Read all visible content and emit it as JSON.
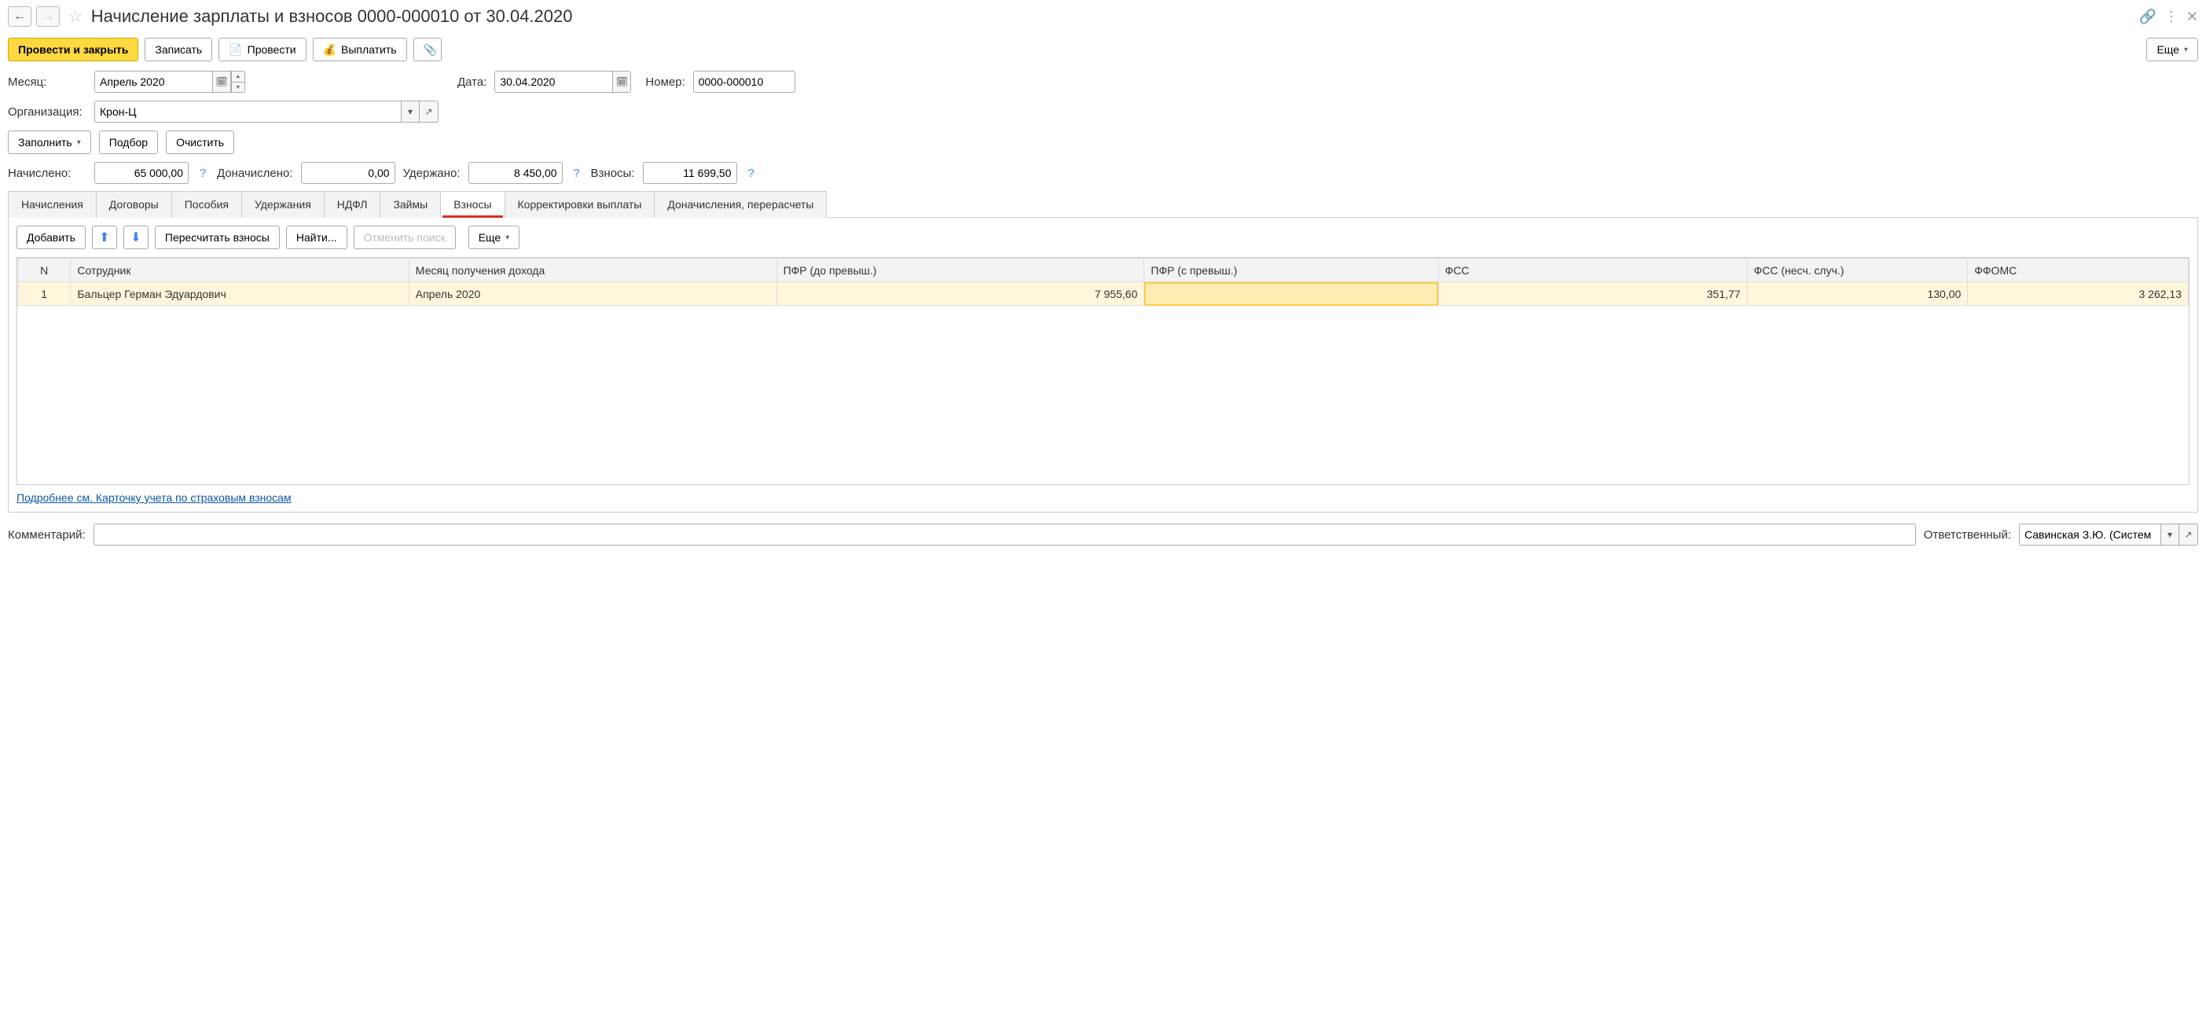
{
  "header": {
    "title": "Начисление зарплаты и взносов 0000-000010 от 30.04.2020"
  },
  "toolbar": {
    "post_and_close": "Провести и закрыть",
    "save": "Записать",
    "post": "Провести",
    "pay": "Выплатить",
    "more": "Еще"
  },
  "form": {
    "month_label": "Месяц:",
    "month_value": "Апрель 2020",
    "date_label": "Дата:",
    "date_value": "30.04.2020",
    "number_label": "Номер:",
    "number_value": "0000-000010",
    "org_label": "Организация:",
    "org_value": "Крон-Ц"
  },
  "mid_toolbar": {
    "fill": "Заполнить",
    "pick": "Подбор",
    "clear": "Очистить"
  },
  "summary": {
    "accrued_label": "Начислено:",
    "accrued_value": "65 000,00",
    "additional_label": "Доначислено:",
    "additional_value": "0,00",
    "withheld_label": "Удержано:",
    "withheld_value": "8 450,00",
    "contrib_label": "Взносы:",
    "contrib_value": "11 699,50"
  },
  "tabs": {
    "items": [
      {
        "label": "Начисления"
      },
      {
        "label": "Договоры"
      },
      {
        "label": "Пособия"
      },
      {
        "label": "Удержания"
      },
      {
        "label": "НДФЛ"
      },
      {
        "label": "Займы"
      },
      {
        "label": "Взносы"
      },
      {
        "label": "Корректировки выплаты"
      },
      {
        "label": "Доначисления, перерасчеты"
      }
    ],
    "active_index": 6
  },
  "inner_toolbar": {
    "add": "Добавить",
    "recalc": "Пересчитать взносы",
    "find": "Найти...",
    "cancel_find": "Отменить поиск",
    "more": "Еще"
  },
  "grid": {
    "columns": [
      "N",
      "Сотрудник",
      "Месяц получения дохода",
      "ПФР (до превыш.)",
      "ПФР (с превыш.)",
      "ФСС",
      "ФСС (несч. случ.)",
      "ФФОМС"
    ],
    "rows": [
      {
        "n": "1",
        "employee": "Бальцер Герман Эдуардович",
        "month": "Апрель 2020",
        "pfr_below": "7 955,60",
        "pfr_above": "",
        "fss": "351,77",
        "fss_acc": "130,00",
        "ffoms": "3 262,13"
      }
    ]
  },
  "link": {
    "details": "Подробнее см. Карточку учета по страховым взносам"
  },
  "footer": {
    "comment_label": "Комментарий:",
    "comment_value": "",
    "responsible_label": "Ответственный:",
    "responsible_value": "Савинская З.Ю. (Систем"
  }
}
